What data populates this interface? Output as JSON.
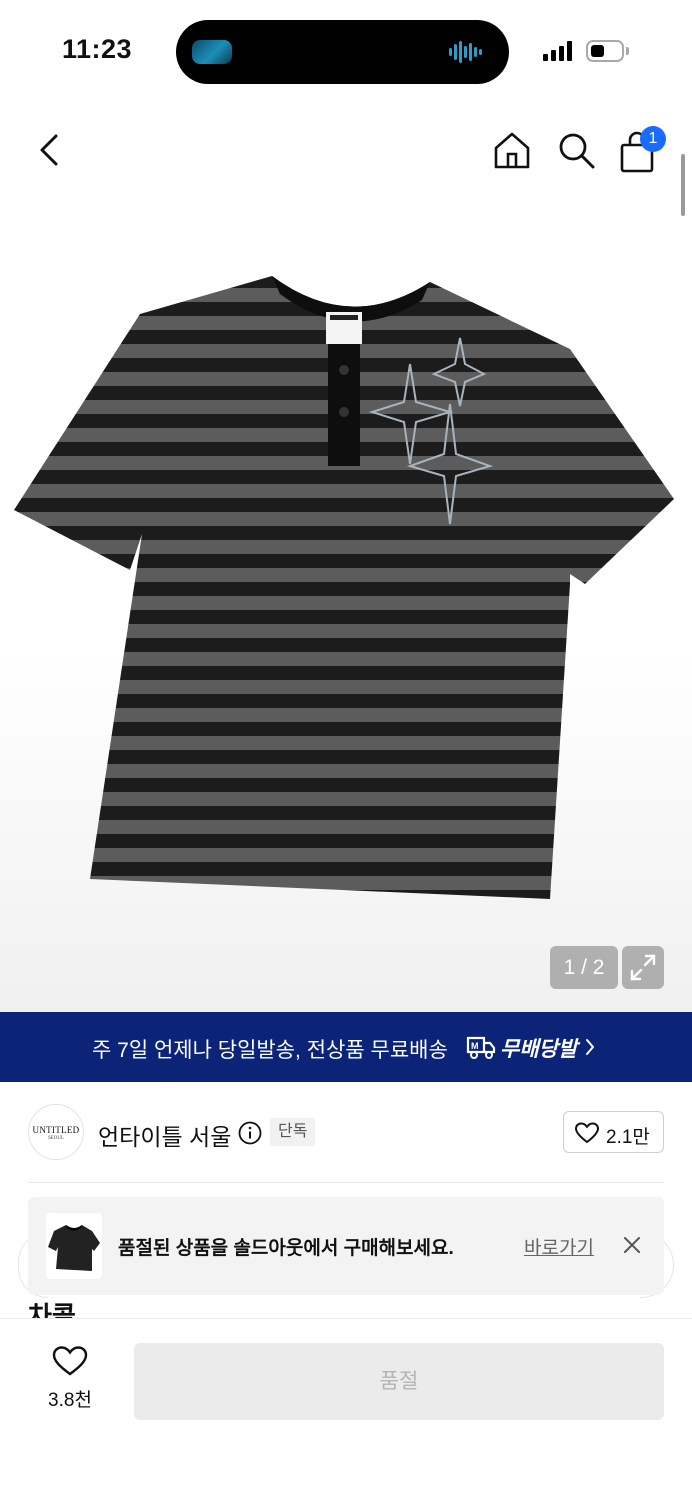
{
  "status_bar": {
    "time": "11:23"
  },
  "product_gallery": {
    "page_current": "1",
    "page_total": "2",
    "page_counter": "1 / 2"
  },
  "header": {
    "cart_count": "1",
    "icons": [
      "back-icon",
      "home-icon",
      "search-icon",
      "shopping-bag-icon"
    ]
  },
  "shipping_banner": {
    "text": "주 7일 언제나 당일발송, 전상품 무료배송",
    "service_name": "무배당발"
  },
  "brand": {
    "logo_text": "UNTITLED",
    "logo_subtext": "SEOUL",
    "name": "언타이틀 서울",
    "badge": "단독",
    "like_count": "2.1만"
  },
  "soldout_notice": {
    "message": "품절된 상품을 솔드아웃에서 구매해보세요.",
    "link_label": "바로가기"
  },
  "peek": {
    "text": "차콜"
  },
  "bottom_bar": {
    "wish_count": "3.8천",
    "buy_label": "품절"
  },
  "colors": {
    "banner_bg": "#0b2478",
    "cart_badge": "#1a6bff",
    "disabled_button": "#ebebeb"
  }
}
